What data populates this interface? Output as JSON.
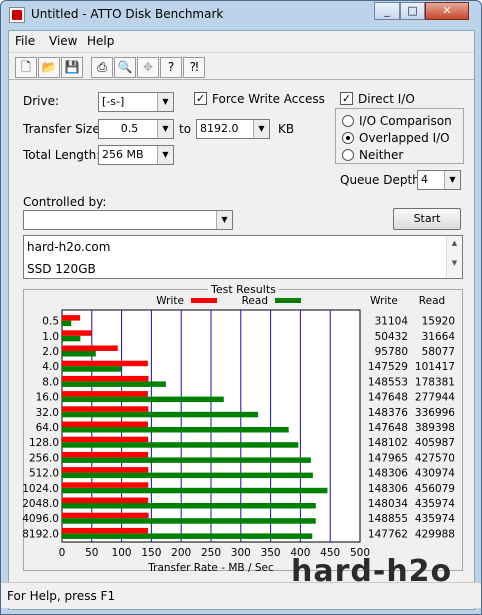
{
  "window": {
    "title": "Untitled - ATTO Disk Benchmark",
    "minimize": "_",
    "maximize": "□",
    "close": "✕"
  },
  "menu": [
    "File",
    "View",
    "Help"
  ],
  "toolbar_icons": [
    "new-icon",
    "open-icon",
    "save-icon",
    "print-icon",
    "print-preview-icon",
    "move-icon",
    "help-icon",
    "context-help-icon"
  ],
  "settings": {
    "drive_label": "Drive:",
    "drive_value": "[-s-]",
    "force_write_label": "Force Write Access",
    "force_write_checked": true,
    "direct_io_label": "Direct I/O",
    "direct_io_checked": true,
    "transfer_size_label": "Transfer Size:",
    "transfer_from": "0.5",
    "to_label": "to",
    "transfer_to": "8192.0",
    "kb_label": "KB",
    "total_length_label": "Total Length:",
    "total_length_value": "256 MB",
    "io_comparison_label": "I/O Comparison",
    "overlapped_io_label": "Overlapped I/O",
    "neither_label": "Neither",
    "selected_mode": "Overlapped I/O",
    "queue_depth_label": "Queue Depth:",
    "queue_depth_value": "4",
    "controlled_by_label": "Controlled by:",
    "controlled_by_value": "",
    "start_button": "Start"
  },
  "notes": [
    "hard-h2o.com",
    "SSD 120GB"
  ],
  "results": {
    "title": "Test Results",
    "write_legend": "Write",
    "read_legend": "Read",
    "write_header": "Write",
    "read_header": "Read",
    "write_color": "#ff0000",
    "read_color": "#008000",
    "rows": [
      {
        "size": "0.5",
        "write": "31104",
        "read": "15920"
      },
      {
        "size": "1.0",
        "write": "50432",
        "read": "31664"
      },
      {
        "size": "2.0",
        "write": "95780",
        "read": "58077"
      },
      {
        "size": "4.0",
        "write": "147529",
        "read": "101417"
      },
      {
        "size": "8.0",
        "write": "148553",
        "read": "178381"
      },
      {
        "size": "16.0",
        "write": "147648",
        "read": "277944"
      },
      {
        "size": "32.0",
        "write": "148376",
        "read": "336996"
      },
      {
        "size": "64.0",
        "write": "147648",
        "read": "389398"
      },
      {
        "size": "128.0",
        "write": "148102",
        "read": "405987"
      },
      {
        "size": "256.0",
        "write": "147965",
        "read": "427570"
      },
      {
        "size": "512.0",
        "write": "148306",
        "read": "430974"
      },
      {
        "size": "1024.0",
        "write": "148306",
        "read": "456079"
      },
      {
        "size": "2048.0",
        "write": "148034",
        "read": "435974"
      },
      {
        "size": "4096.0",
        "write": "148855",
        "read": "435974"
      },
      {
        "size": "8192.0",
        "write": "147762",
        "read": "429988"
      }
    ],
    "x_ticks": [
      "0",
      "50",
      "100",
      "150",
      "200",
      "250",
      "300",
      "350",
      "400",
      "450",
      "500"
    ],
    "x_label": "Transfer Rate - MB / Sec"
  },
  "chart_data": {
    "type": "bar",
    "categories": [
      "0.5",
      "1.0",
      "2.0",
      "4.0",
      "8.0",
      "16.0",
      "32.0",
      "64.0",
      "128.0",
      "256.0",
      "512.0",
      "1024.0",
      "2048.0",
      "4096.0",
      "8192.0"
    ],
    "series": [
      {
        "name": "Write",
        "values": [
          30.4,
          49.3,
          93.5,
          144.1,
          145.1,
          144.2,
          144.9,
          144.2,
          144.6,
          144.5,
          144.8,
          144.8,
          144.6,
          145.4,
          144.3
        ]
      },
      {
        "name": "Read",
        "values": [
          15.5,
          30.9,
          56.7,
          99.0,
          174.2,
          271.4,
          329.1,
          380.3,
          396.5,
          417.5,
          420.9,
          445.4,
          425.8,
          425.8,
          419.9
        ]
      }
    ],
    "xlabel": "Transfer Rate - MB / Sec",
    "xlim": [
      0,
      500
    ],
    "orientation": "horizontal"
  },
  "watermark": "hard-h2o",
  "status": "For Help, press F1"
}
